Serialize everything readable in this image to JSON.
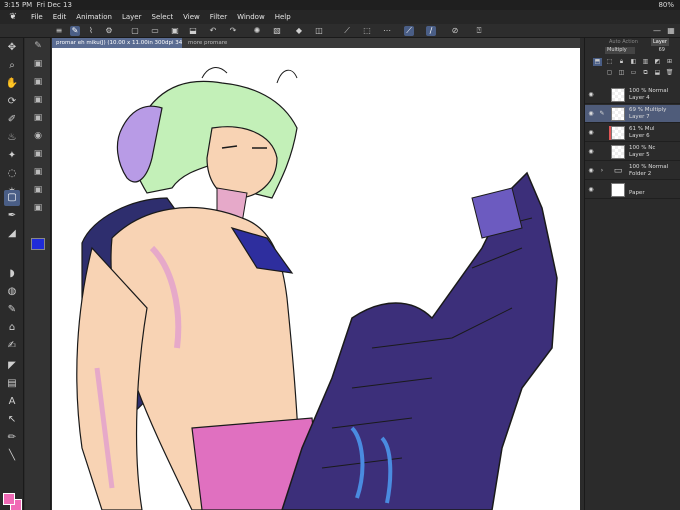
{
  "status": {
    "time": "3:15 PM",
    "date": "Fri Dec 13",
    "battery": "80%"
  },
  "menu": {
    "items": [
      "File",
      "Edit",
      "Animation",
      "Layer",
      "Select",
      "View",
      "Filter",
      "Window",
      "Help"
    ]
  },
  "tabs": {
    "active": "promar eh miku(J) (10.00 x 11.00in 300dpi 341.0%)",
    "inactive": "more promare"
  },
  "layer_panel": {
    "tab_auto_action": "Auto Action",
    "tab_layer": "Layer",
    "blend_mode": "Multiply",
    "opacity_value": "69",
    "layers": [
      {
        "line1": "100 % Normal",
        "line2": "Layer 4"
      },
      {
        "line1": "69 % Multiply",
        "line2": "Layer 7"
      },
      {
        "line1": "61 % Mul",
        "line2": "Layer 6"
      },
      {
        "line1": "100 % Nc",
        "line2": "Layer 5"
      },
      {
        "line1": "100 % Normal",
        "line2": "Folder 2"
      },
      {
        "line1": "",
        "line2": "Paper"
      }
    ]
  },
  "colors": {
    "main_color": "#f06ab6",
    "sub_color": "#f06ab6",
    "accent": "#4a5e86"
  }
}
